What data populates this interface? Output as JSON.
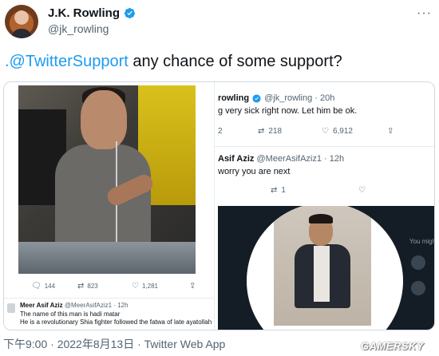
{
  "author": {
    "display_name": "J.K. Rowling",
    "handle": "@jk_rowling",
    "verified_icon": "verified-badge-icon"
  },
  "more_glyph": "···",
  "tweet": {
    "mention": ".@TwitterSupport",
    "body": " any chance of some support?"
  },
  "left_shot": {
    "actions": {
      "replies": "144",
      "retweets": "823",
      "likes": "1,281"
    },
    "reply": {
      "name": "Meer Asif Aziz",
      "meta": "@MeerAsifAziz1 · 12h",
      "line1": "The name of this man is hadi matar",
      "line2": "He is a revolutionary Shia fighter followed the fatwa of late ayatollah"
    }
  },
  "right_shot": {
    "tweet1": {
      "name": "rowling",
      "meta": "@jk_rowling · 20h",
      "text": "g very sick right now. Let him be ok.",
      "replies": "2",
      "retweets": "218",
      "likes": "6,912"
    },
    "tweet2": {
      "name": "Asif Aziz",
      "meta": "@MeerAsifAziz1 · 12h",
      "text": "worry you are next",
      "retweets": "1"
    },
    "side_label": "You migh"
  },
  "footer": {
    "timestamp": "下午9:00 · 2022年8月13日 · Twitter Web App"
  },
  "watermark": "GAMERSKY",
  "colors": {
    "link": "#1d9bf0",
    "text": "#0f1419",
    "secondary": "#536471"
  }
}
